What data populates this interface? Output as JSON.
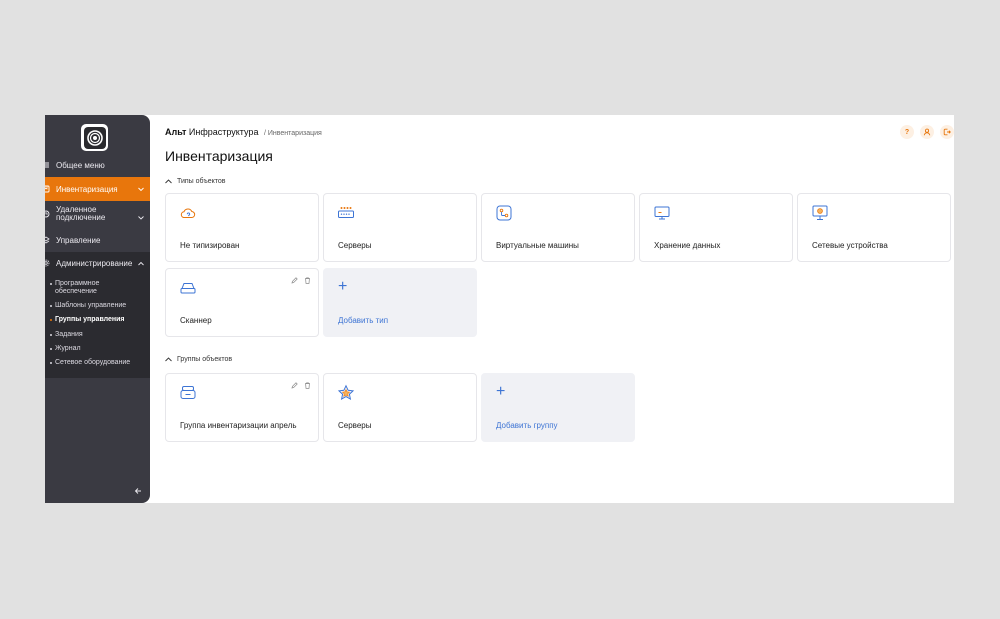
{
  "sidebar": {
    "logo": "alt-logo",
    "items": [
      {
        "label": "Общее меню",
        "icon": "menu-icon"
      },
      {
        "label": "Инвентаризация",
        "icon": "inventory-icon",
        "active": true
      },
      {
        "label": "Удаленное подключение",
        "icon": "remote-icon"
      },
      {
        "label": "Управление",
        "icon": "manage-icon"
      },
      {
        "label": "Администрирование",
        "icon": "admin-icon"
      }
    ],
    "sub_items": [
      {
        "label": "Программное обеспечение"
      },
      {
        "label": "Шаблоны управление"
      },
      {
        "label": "Группы управления",
        "active": true
      },
      {
        "label": "Задания"
      },
      {
        "label": "Журнал"
      },
      {
        "label": "Сетевое оборудование"
      }
    ]
  },
  "header": {
    "brand_bold": "Альт",
    "brand_rest": "Инфраструктура",
    "crumb": "/ Инвентаризация",
    "help": "?"
  },
  "page": {
    "title": "Инвентаризация"
  },
  "types_section": {
    "title": "Типы объектов",
    "cards": [
      {
        "label": "Не типизирован",
        "icon": "untyped-cloud-icon"
      },
      {
        "label": "Серверы",
        "icon": "servers-icon"
      },
      {
        "label": "Виртуальные машины",
        "icon": "virtual-machines-icon"
      },
      {
        "label": "Хранение данных",
        "icon": "data-storage-icon"
      },
      {
        "label": "Сетевые устройства",
        "icon": "network-devices-icon"
      },
      {
        "label": "Сканнер",
        "icon": "scanner-icon"
      }
    ],
    "add_label": "Добавить тип",
    "add_symbol": "+"
  },
  "groups_section": {
    "title": "Группы объектов",
    "cards": [
      {
        "label": "Группа инвентаризации апрель",
        "icon": "group-box-icon"
      },
      {
        "label": "Серверы",
        "icon": "star-icon"
      }
    ],
    "add_label": "Добавить группу",
    "add_symbol": "+"
  },
  "colors": {
    "accent": "#e8760c",
    "sidebar_bg": "#3a3a42",
    "link_blue": "#3d74d4"
  }
}
